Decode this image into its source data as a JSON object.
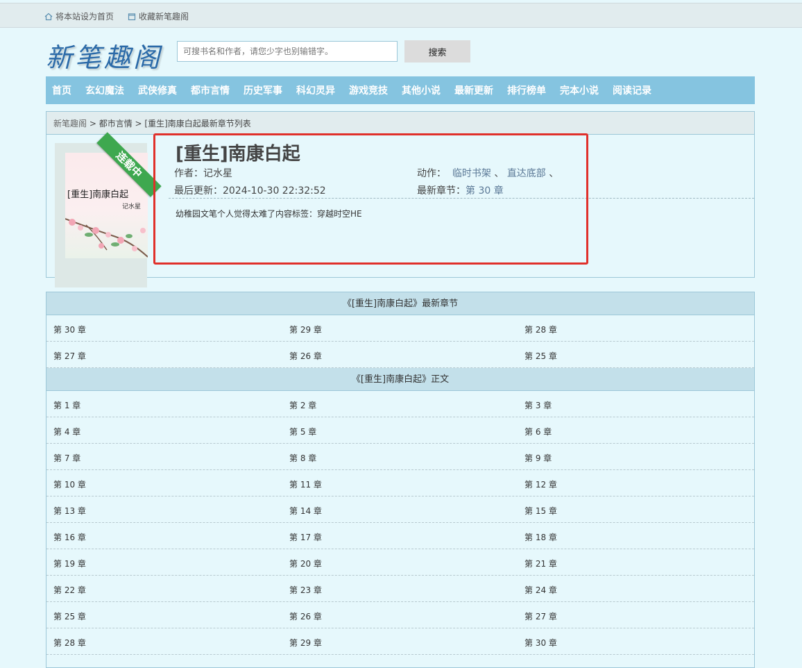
{
  "topbar": {
    "set_home": "将本站设为首页",
    "bookmark": "收藏新笔趣阁"
  },
  "header": {
    "logo": "新笔趣阁",
    "search_placeholder": "可搜书名和作者，请您少字也别输错字。",
    "search_button": "搜索"
  },
  "nav": [
    "首页",
    "玄幻魔法",
    "武侠修真",
    "都市言情",
    "历史军事",
    "科幻灵异",
    "游戏竞技",
    "其他小说",
    "最新更新",
    "排行榜单",
    "完本小说",
    "阅读记录"
  ],
  "breadcrumb": {
    "home": "新笔趣阁",
    "sep1": " > ",
    "category": "都市言情",
    "sep2": " > ",
    "current": "[重生]南康白起最新章节列表"
  },
  "book": {
    "cover_title": "[重生]南康白起",
    "cover_author": "记水星",
    "status_ribbon": "连载中",
    "title": "[重生]南康白起",
    "author_label": "作者：",
    "author": "记水星",
    "actions_label": "动作：",
    "action_shelf": "临时书架",
    "action_sep1": " 、 ",
    "action_bottom": "直达底部",
    "action_sep2": " 、",
    "updated_label": "最后更新：",
    "updated": "2024-10-30 22:32:52",
    "latest_label": "最新章节：",
    "latest": "第 30 章",
    "intro": "幼稚园文笔个人觉得太难了内容标签：穿越时空HE"
  },
  "latest_section": {
    "title": "《[重生]南康白起》最新章节",
    "rows": [
      [
        "第 30 章",
        "第 29 章",
        "第 28 章"
      ],
      [
        "第 27 章",
        "第 26 章",
        "第 25 章"
      ]
    ]
  },
  "main_section": {
    "title": "《[重生]南康白起》正文",
    "rows": [
      [
        "第 1 章",
        "第 2 章",
        "第 3 章"
      ],
      [
        "第 4 章",
        "第 5 章",
        "第 6 章"
      ],
      [
        "第 7 章",
        "第 8 章",
        "第 9 章"
      ],
      [
        "第 10 章",
        "第 11 章",
        "第 12 章"
      ],
      [
        "第 13 章",
        "第 14 章",
        "第 15 章"
      ],
      [
        "第 16 章",
        "第 17 章",
        "第 18 章"
      ],
      [
        "第 19 章",
        "第 20 章",
        "第 21 章"
      ],
      [
        "第 22 章",
        "第 23 章",
        "第 24 章"
      ],
      [
        "第 25 章",
        "第 26 章",
        "第 27 章"
      ],
      [
        "第 28 章",
        "第 29 章",
        "第 30 章"
      ]
    ]
  },
  "colors": {
    "nav_bg": "#85c4e0",
    "highlight": "#e0302a",
    "ribbon": "#3ea84f"
  }
}
